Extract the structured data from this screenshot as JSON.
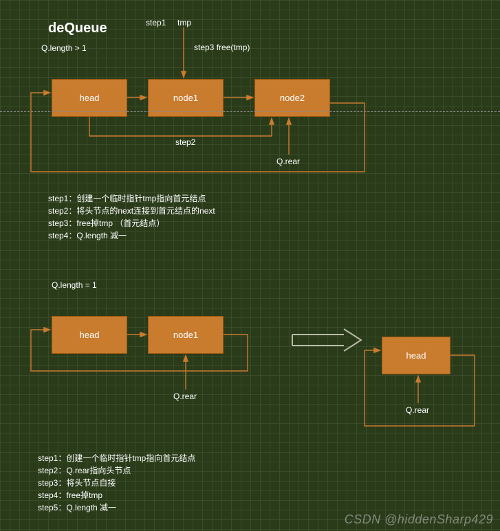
{
  "title": "deQueue",
  "section1": {
    "condition": "Q.length > 1",
    "labels": {
      "step1": "step1",
      "tmp": "tmp",
      "step3": "step3 free(tmp)",
      "step2": "step2",
      "qrear": "Q.rear"
    },
    "nodes": {
      "head": "head",
      "node1": "node1",
      "node2": "node2"
    },
    "steps": [
      "step1：创建一个临时指针tmp指向首元结点",
      "step2：将头节点的next连接到首元结点的next",
      "step3：free掉tmp （首元结点）",
      "step4：Q.length 减一"
    ]
  },
  "section2": {
    "condition": "Q.length = 1",
    "labels": {
      "qrear_left": "Q.rear",
      "qrear_right": "Q.rear"
    },
    "nodes": {
      "head": "head",
      "node1": "node1",
      "head_after": "head"
    },
    "steps": [
      "step1：创建一个临时指针tmp指向首元结点",
      "step2：Q.rear指向头节点",
      "step3：将头节点自接",
      "step4：free掉tmp",
      "step5：Q.length 减一"
    ]
  },
  "watermark": "CSDN @hiddenSharp429",
  "colors": {
    "node_fill": "#c97b2e",
    "node_border": "#a05a0f",
    "line": "#c97b2e"
  }
}
